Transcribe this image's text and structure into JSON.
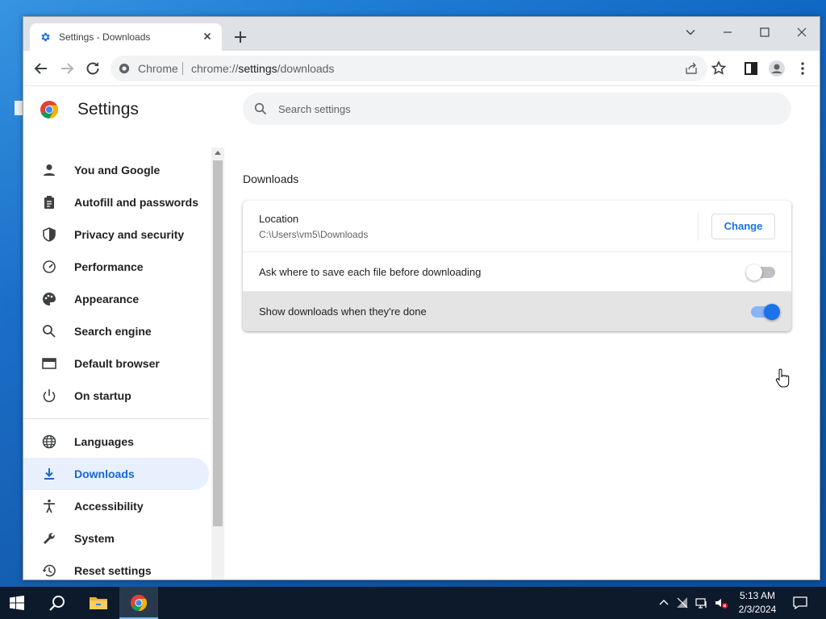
{
  "browser": {
    "tab_title": "Settings - Downloads",
    "omnibox_chip": "Chrome",
    "url_scheme": "chrome://",
    "url_host": "settings",
    "url_path": "/downloads"
  },
  "settings": {
    "title": "Settings",
    "search_placeholder": "Search settings",
    "nav": [
      {
        "label": "You and Google",
        "icon": "person-icon"
      },
      {
        "label": "Autofill and passwords",
        "icon": "clipboard-icon"
      },
      {
        "label": "Privacy and security",
        "icon": "shield-icon"
      },
      {
        "label": "Performance",
        "icon": "speedometer-icon"
      },
      {
        "label": "Appearance",
        "icon": "palette-icon"
      },
      {
        "label": "Search engine",
        "icon": "search-icon"
      },
      {
        "label": "Default browser",
        "icon": "browser-icon"
      },
      {
        "label": "On startup",
        "icon": "power-icon"
      },
      {
        "label": "Languages",
        "icon": "globe-icon"
      },
      {
        "label": "Downloads",
        "icon": "download-icon",
        "active": true
      },
      {
        "label": "Accessibility",
        "icon": "accessibility-icon"
      },
      {
        "label": "System",
        "icon": "wrench-icon"
      },
      {
        "label": "Reset settings",
        "icon": "history-icon"
      }
    ],
    "section_title": "Downloads",
    "location_label": "Location",
    "location_value": "C:\\Users\\vm5\\Downloads",
    "change_button": "Change",
    "ask_label": "Ask where to save each file before downloading",
    "ask_enabled": false,
    "show_label": "Show downloads when they're done",
    "show_enabled": true
  },
  "taskbar": {
    "time": "5:13 AM",
    "date": "2/3/2024"
  },
  "colors": {
    "accent": "#1a73e8",
    "active_nav_bg": "#e8f0fe",
    "active_nav_text": "#1967d2",
    "taskbar": "#0d1a2b",
    "desktop": "#0f67c4"
  }
}
